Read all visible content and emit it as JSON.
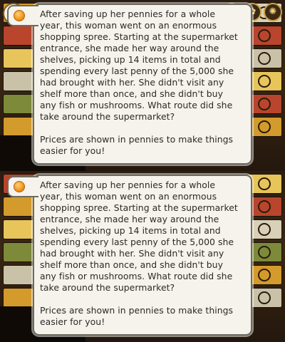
{
  "puzzle": {
    "paragraph_1_lines": [
      "After saving up her pennies for a whole",
      "year, this woman went on an enormous",
      "shopping spree. Starting at the supermarket",
      "entrance, she made her way around the",
      "shelves, picking up 14 items in total and",
      "spending every last penny of the 5,000 she",
      "had brought with her. She didn't visit any",
      "shelf more than once, and she didn't buy",
      "any fish or mushrooms. What route did she",
      "take around the supermarket?"
    ],
    "paragraph_2_lines": [
      "Prices are shown in pennies to make things",
      "easier for you!"
    ]
  },
  "icons": {
    "dialog_bullet": "orange-orb-icon",
    "corner_badge": "corner-badge-icon",
    "top_right": [
      "memo-icon",
      "hint-icon",
      "settings-icon"
    ]
  },
  "colors": {
    "dialog_bg": "#f5f3ec",
    "dialog_border": "#6d6a5e",
    "text": "#2b2a25",
    "bullet": "#f29a1e"
  }
}
